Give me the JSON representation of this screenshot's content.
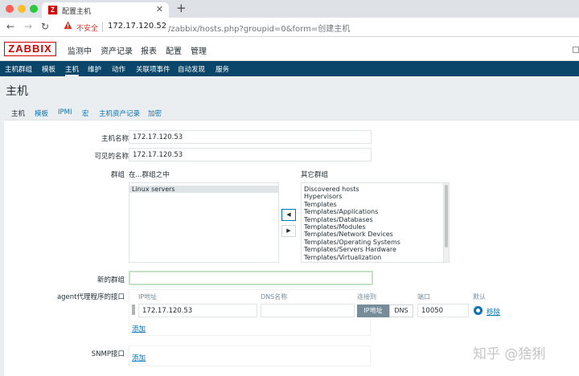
{
  "browser": {
    "tab_title": "配置主机",
    "tab_favicon": "Z",
    "insecure_label": "不安全",
    "url_host": "172.17.120.52",
    "url_path": "/zabbix/hosts.php?groupid=0&form=创建主机"
  },
  "header": {
    "logo": "ZABBIX",
    "menu": [
      "监测中",
      "资产记录",
      "报表",
      "配置",
      "管理"
    ]
  },
  "subnav": [
    "主机群组",
    "模板",
    "主机",
    "维护",
    "动作",
    "关联项事件",
    "自动发现",
    "服务"
  ],
  "page_title": "主机",
  "form_tabs": [
    "主机",
    "模板",
    "IPMI",
    "宏",
    "主机资产记录",
    "加密"
  ],
  "form": {
    "host_name_label": "主机名称",
    "host_name_value": "172.17.120.53",
    "visible_name_label": "可见的名称",
    "visible_name_value": "172.17.120.53",
    "groups_label": "群组",
    "in_groups_label": "在...群组之中",
    "other_groups_label": "其它群组",
    "in_groups": [
      "Linux servers"
    ],
    "other_groups": [
      "Discovered hosts",
      "Hypervisors",
      "Templates",
      "Templates/Applications",
      "Templates/Databases",
      "Templates/Modules",
      "Templates/Network Devices",
      "Templates/Operating Systems",
      "Templates/Servers Hardware",
      "Templates/Virtualization"
    ],
    "move_left": "◀",
    "move_right": "▶",
    "new_group_label": "新的群组",
    "new_group_value": "",
    "agent_label": "agent代理程序的接口",
    "cols": {
      "ip": "IP地址",
      "dns": "DNS名称",
      "connect": "连接到",
      "port": "端口",
      "default": "默认"
    },
    "agent_ip": "172.17.120.53",
    "agent_dns": "",
    "connect_ip": "IP地址",
    "connect_dns": "DNS",
    "agent_port": "10050",
    "remove_link": "移除",
    "add_link": "添加",
    "snmp_label": "SNMP接口",
    "snmp_add_link": "添加"
  },
  "watermark": "知乎 @猞猁"
}
